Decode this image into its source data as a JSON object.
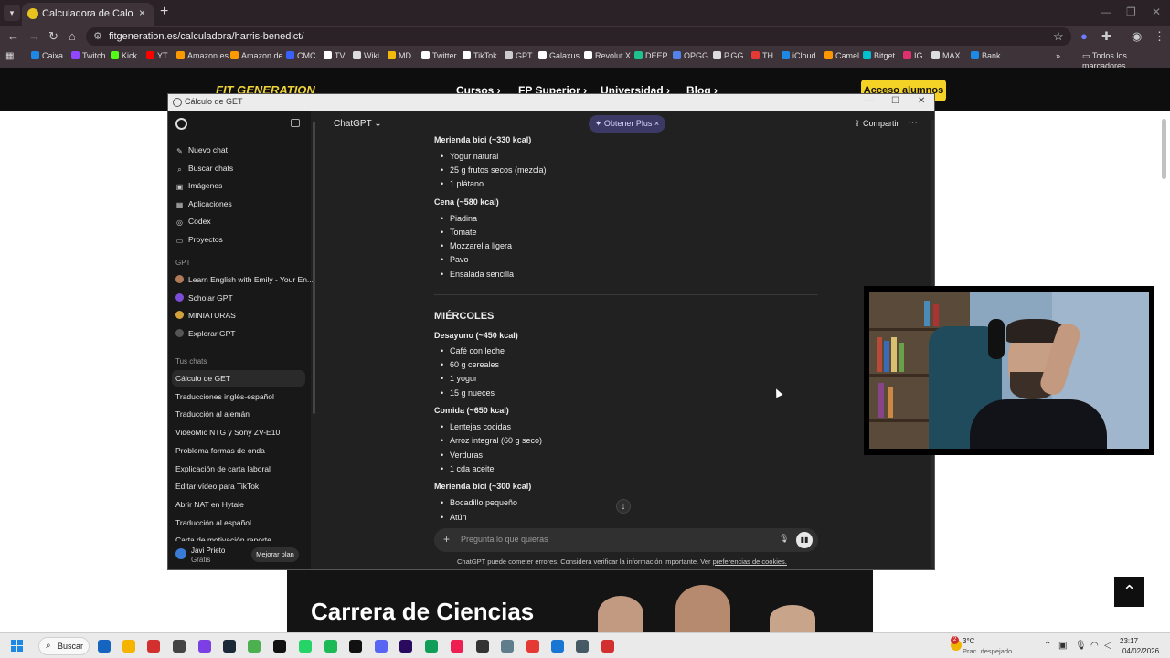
{
  "browser": {
    "tab_title": "Calculadora de Calorías Harris",
    "url": "fitgeneration.es/calculadora/harris-benedict/",
    "bookmarks": [
      {
        "label": "Caixa",
        "color": "#1e88e5"
      },
      {
        "label": "Twitch",
        "color": "#9146ff"
      },
      {
        "label": "Kick",
        "color": "#53fc18"
      },
      {
        "label": "YT",
        "color": "#ff0000"
      },
      {
        "label": "Amazon.es",
        "color": "#ff9900"
      },
      {
        "label": "Amazon.de",
        "color": "#ff9900"
      },
      {
        "label": "CMC",
        "color": "#3861fb"
      },
      {
        "label": "TV",
        "color": "#ffffff"
      },
      {
        "label": "Wiki",
        "color": "#dddddd"
      },
      {
        "label": "MD",
        "color": "#f0b90b"
      },
      {
        "label": "Twitter",
        "color": "#ffffff"
      },
      {
        "label": "TikTok",
        "color": "#ffffff"
      },
      {
        "label": "GPT",
        "color": "#cccccc"
      },
      {
        "label": "Galaxus",
        "color": "#ffffff"
      },
      {
        "label": "Revolut X",
        "color": "#ffffff"
      },
      {
        "label": "DEEP",
        "color": "#1ec28b"
      },
      {
        "label": "OPGG",
        "color": "#5383e8"
      },
      {
        "label": "P.GG",
        "color": "#dddddd"
      },
      {
        "label": "TH",
        "color": "#e53935"
      },
      {
        "label": "iCloud",
        "color": "#1e88e5"
      },
      {
        "label": "Camel",
        "color": "#ff9800"
      },
      {
        "label": "Bitget",
        "color": "#00c2d1"
      },
      {
        "label": "IG",
        "color": "#e1306c"
      },
      {
        "label": "MAX",
        "color": "#dddddd"
      },
      {
        "label": "Bank",
        "color": "#1e88e5"
      }
    ],
    "all_bookmarks": "Todos los marcadores"
  },
  "site": {
    "logo": "FIT GENERATION",
    "nav": [
      "Cursos",
      "FP Superior",
      "Universidad",
      "Blog"
    ],
    "login_button": "Acceso alumnos",
    "hero_title": "Carrera de Ciencias"
  },
  "chat_window": {
    "title": "Cálculo de GET"
  },
  "sidebar": {
    "nav": [
      {
        "label": "Nuevo chat",
        "icon": "new-chat-icon"
      },
      {
        "label": "Buscar chats",
        "icon": "search-icon"
      },
      {
        "label": "Imágenes",
        "icon": "image-icon"
      },
      {
        "label": "Aplicaciones",
        "icon": "apps-icon"
      },
      {
        "label": "Codex",
        "icon": "codex-icon"
      },
      {
        "label": "Proyectos",
        "icon": "folder-icon"
      }
    ],
    "gpt_section": "GPT",
    "gpts": [
      {
        "label": "Learn English with Emily - Your En...",
        "color": "#b07a5a"
      },
      {
        "label": "Scholar GPT",
        "color": "#7b4dd8"
      },
      {
        "label": "MINIATURAS",
        "color": "#d4a23a"
      },
      {
        "label": "Explorar GPT",
        "color": "#555555"
      }
    ],
    "chats_section": "Tus chats",
    "chats": [
      "Cálculo de GET",
      "Traducciones inglés-español",
      "Traducción al alemán",
      "VideoMic NTG y Sony ZV-E10",
      "Problema formas de onda",
      "Explicación de carta laboral",
      "Editar vídeo para TikTok",
      "Abrir NAT en Hytale",
      "Traducción al español",
      "Carta de motivación reporte"
    ],
    "user_name": "Javi Prieto",
    "user_plan": "Gratis",
    "upgrade_button": "Mejorar plan"
  },
  "main": {
    "model": "ChatGPT",
    "obtener_plus": "Obtener Plus",
    "share": "Compartir",
    "content": [
      {
        "type": "meal",
        "text": "Merienda bici (~330 kcal)"
      },
      {
        "type": "item",
        "text": "Yogur natural"
      },
      {
        "type": "item",
        "text": "25 g frutos secos (mezcla)"
      },
      {
        "type": "item",
        "text": "1 plátano"
      },
      {
        "type": "meal",
        "text": "Cena (~580 kcal)"
      },
      {
        "type": "item",
        "text": "Piadina"
      },
      {
        "type": "item",
        "text": "Tomate"
      },
      {
        "type": "item",
        "text": "Mozzarella ligera"
      },
      {
        "type": "item",
        "text": "Pavo"
      },
      {
        "type": "item",
        "text": "Ensalada sencilla"
      },
      {
        "type": "day",
        "text": "MIÉRCOLES"
      },
      {
        "type": "meal",
        "text": "Desayuno (~450 kcal)"
      },
      {
        "type": "item",
        "text": "Café con leche"
      },
      {
        "type": "item",
        "text": "60 g cereales"
      },
      {
        "type": "item",
        "text": "1 yogur"
      },
      {
        "type": "item",
        "text": "15 g nueces"
      },
      {
        "type": "meal",
        "text": "Comida (~650 kcal)"
      },
      {
        "type": "item",
        "text": "Lentejas cocidas"
      },
      {
        "type": "item",
        "text": "Arroz integral (60 g seco)"
      },
      {
        "type": "item",
        "text": "Verduras"
      },
      {
        "type": "item",
        "text": "1 cda aceite"
      },
      {
        "type": "meal",
        "text": "Merienda bici (~300 kcal)"
      },
      {
        "type": "item",
        "text": "Bocadillo pequeño"
      },
      {
        "type": "item",
        "text": "Atún"
      }
    ],
    "composer_placeholder": "Pregunta lo que quieras",
    "disclaimer": "ChatGPT puede cometer errores. Considera verificar la información importante. Ver",
    "disclaimer_link": "preferencias de cookies."
  },
  "taskbar": {
    "search": "Buscar",
    "weather_temp": "3°C",
    "weather_status": "Prac. despejado",
    "weather_badge": "2",
    "time": "23:17",
    "date": "04/02/2026"
  }
}
